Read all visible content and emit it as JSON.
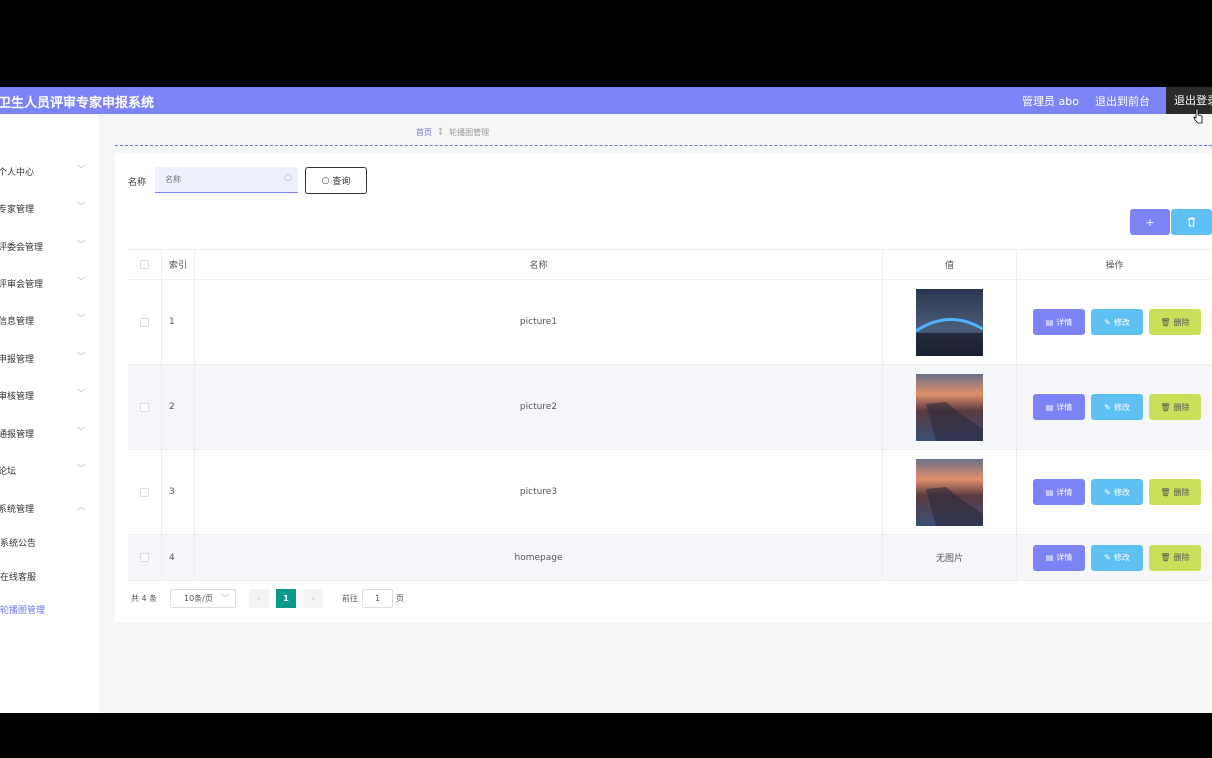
{
  "header": {
    "title": "卫生人员评审专家申报系统",
    "admin": "管理员 abo",
    "to_front": "退出到前台",
    "logout": "退出登录"
  },
  "sidebar": {
    "items": [
      {
        "label": "个人中心",
        "expanded": false
      },
      {
        "label": "专家管理",
        "expanded": false
      },
      {
        "label": "评委会管理",
        "expanded": false
      },
      {
        "label": "评审会管理",
        "expanded": false
      },
      {
        "label": "信息管理",
        "expanded": false
      },
      {
        "label": "申报管理",
        "expanded": false
      },
      {
        "label": "审核管理",
        "expanded": false
      },
      {
        "label": "通报管理",
        "expanded": false
      },
      {
        "label": "论坛",
        "expanded": false
      },
      {
        "label": "系统管理",
        "expanded": true
      }
    ],
    "subitems": [
      {
        "label": "系统公告",
        "active": false
      },
      {
        "label": "在线客服",
        "active": false
      },
      {
        "label": "轮播图管理",
        "active": true
      }
    ]
  },
  "breadcrumb": {
    "home": "首页",
    "sep": "⁑",
    "current": "轮播图管理"
  },
  "search": {
    "label": "名称",
    "placeholder": "名称",
    "button": "查询"
  },
  "actions": {
    "add": "+",
    "delete": "🗑"
  },
  "table": {
    "headers": [
      "索引",
      "名称",
      "值",
      "操作"
    ],
    "rows": [
      {
        "index": "1",
        "name": "picture1",
        "image": "bridge",
        "value_text": ""
      },
      {
        "index": "2",
        "name": "picture2",
        "image": "sunset",
        "value_text": ""
      },
      {
        "index": "3",
        "name": "picture3",
        "image": "sunset",
        "value_text": ""
      },
      {
        "index": "4",
        "name": "homepage",
        "image": "none",
        "value_text": "无图片"
      }
    ],
    "ops": {
      "detail": "详情",
      "edit": "修改",
      "delete": "删除"
    }
  },
  "pagination": {
    "total": "共 4 条",
    "page_size": "10条/页",
    "current": "1",
    "goto_label": "前往",
    "goto_value": "1",
    "page_suffix": "页"
  },
  "colors": {
    "accent": "#7b83f5",
    "info": "#5ec0f3",
    "warn": "#c8e05a",
    "pager": "#0a9a8a"
  }
}
